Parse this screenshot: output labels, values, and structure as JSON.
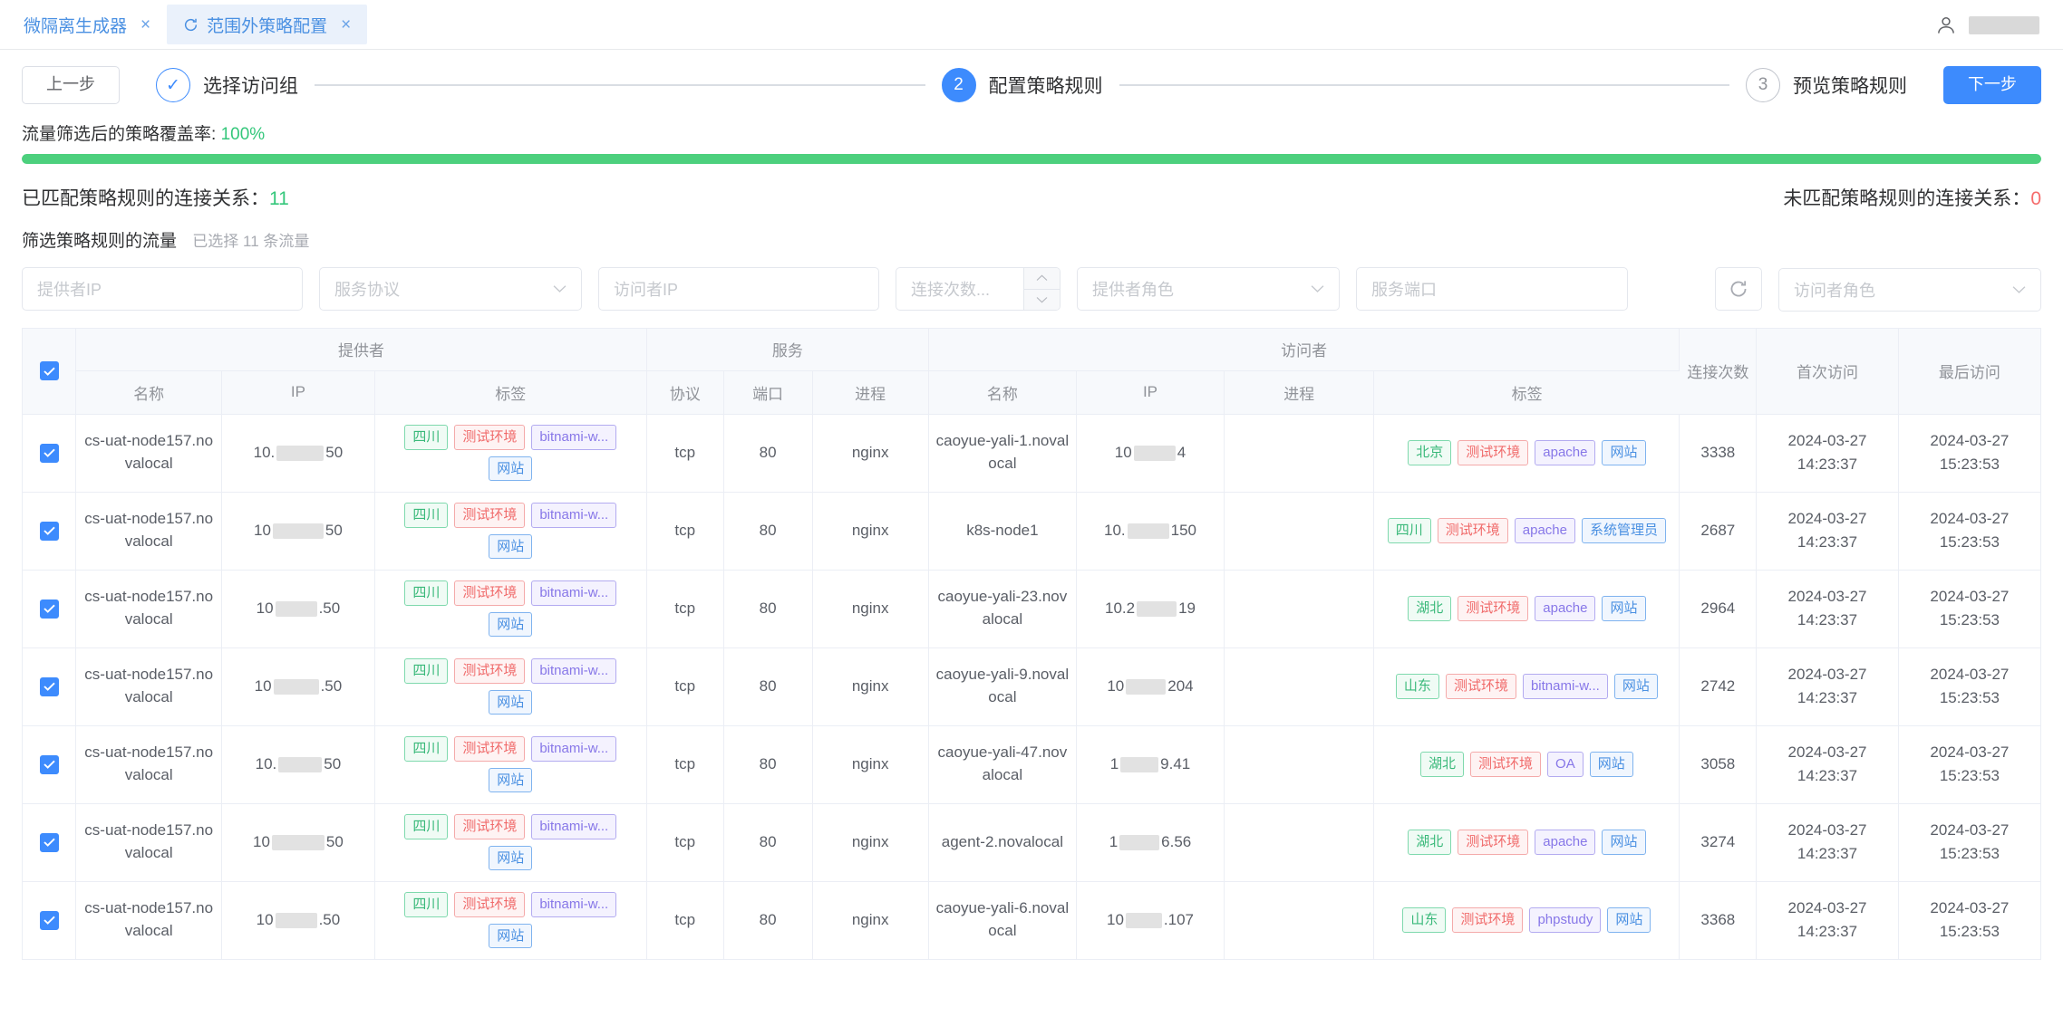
{
  "tabs": [
    {
      "label": "微隔离生成器",
      "active": false,
      "has_refresh": false,
      "close": "×"
    },
    {
      "label": "范围外策略配置",
      "active": true,
      "has_refresh": true,
      "close": "×"
    }
  ],
  "topbar": {
    "user_icon": "user-icon"
  },
  "stepbar": {
    "prev_label": "上一步",
    "next_label": "下一步",
    "steps": [
      {
        "marker": "✓",
        "label": "选择访问组",
        "state": "done"
      },
      {
        "marker": "2",
        "label": "配置策略规则",
        "state": "current"
      },
      {
        "marker": "3",
        "label": "预览策略规则",
        "state": "todo"
      }
    ]
  },
  "coverage": {
    "label": "流量筛选后的策略覆盖率:",
    "value": "100%",
    "percent": 100,
    "bar_color": "#4cd07d"
  },
  "counts": {
    "matched_label": "已匹配策略规则的连接关系：",
    "matched_value": "11",
    "matched_color": "#34c77b",
    "unmatched_label": "未匹配策略规则的连接关系：",
    "unmatched_value": "0",
    "unmatched_color": "#f56c6c"
  },
  "filter_section": {
    "title": "筛选策略规则的流量",
    "hint": "已选择 11 条流量",
    "fields": [
      {
        "name": "provider-ip",
        "placeholder": "提供者IP",
        "type": "text",
        "width": "w310"
      },
      {
        "name": "service-protocol",
        "placeholder": "服务协议",
        "type": "select",
        "width": "w290"
      },
      {
        "name": "visitor-ip",
        "placeholder": "访问者IP",
        "type": "text",
        "width": "w310"
      },
      {
        "name": "connection-count",
        "placeholder": "连接次数...",
        "type": "number",
        "width": ""
      },
      {
        "name": "provider-role",
        "placeholder": "提供者角色",
        "type": "select",
        "width": "w290"
      },
      {
        "name": "service-port",
        "placeholder": "服务端口",
        "type": "text",
        "width": "w300"
      },
      {
        "name": "visitor-role",
        "placeholder": "访问者角色",
        "type": "select",
        "width": "w290"
      }
    ],
    "refresh_icon": "refresh-icon"
  },
  "table": {
    "group_headers": [
      {
        "label": "提供者",
        "span": 3
      },
      {
        "label": "服务",
        "span": 3
      },
      {
        "label": "访问者",
        "span": 4
      },
      {
        "label": "连接次数",
        "span": 1,
        "rowspan": true
      },
      {
        "label": "首次访问",
        "span": 1,
        "rowspan": true
      },
      {
        "label": "最后访问",
        "span": 1,
        "rowspan": true
      }
    ],
    "sub_headers": [
      "名称",
      "IP",
      "标签",
      "协议",
      "端口",
      "进程",
      "名称",
      "IP",
      "进程",
      "标签"
    ],
    "header_all_checked": true,
    "rows": [
      {
        "checked": true,
        "provider_name": "cs-uat-node157.novalocal",
        "provider_ip_prefix": "10.",
        "provider_ip_suffix": "50",
        "provider_ip_blur_w": 52,
        "provider_tags": [
          {
            "text": "四川",
            "color": "green"
          },
          {
            "text": "测试环境",
            "color": "red"
          },
          {
            "text": "bitnami-w...",
            "color": "purple"
          },
          {
            "text": "网站",
            "color": "blue"
          }
        ],
        "protocol": "tcp",
        "port": "80",
        "process": "nginx",
        "visitor_name": "caoyue-yali-1.novalocal",
        "visitor_ip_prefix": "10",
        "visitor_ip_suffix": "4",
        "visitor_ip_blur_w": 46,
        "visitor_process": "",
        "visitor_tags": [
          {
            "text": "北京",
            "color": "green"
          },
          {
            "text": "测试环境",
            "color": "red"
          },
          {
            "text": "apache",
            "color": "purple"
          },
          {
            "text": "网站",
            "color": "blue"
          }
        ],
        "conn_count": "3338",
        "first_visit_date": "2024-03-27",
        "first_visit_time": "14:23:37",
        "last_visit_date": "2024-03-27",
        "last_visit_time": "15:23:53"
      },
      {
        "checked": true,
        "provider_name": "cs-uat-node157.novalocal",
        "provider_ip_prefix": "10",
        "provider_ip_suffix": "50",
        "provider_ip_blur_w": 56,
        "provider_tags": [
          {
            "text": "四川",
            "color": "green"
          },
          {
            "text": "测试环境",
            "color": "red"
          },
          {
            "text": "bitnami-w...",
            "color": "purple"
          },
          {
            "text": "网站",
            "color": "blue"
          }
        ],
        "protocol": "tcp",
        "port": "80",
        "process": "nginx",
        "visitor_name": "k8s-node1",
        "visitor_ip_prefix": "10.",
        "visitor_ip_suffix": "150",
        "visitor_ip_blur_w": 46,
        "visitor_process": "",
        "visitor_tags": [
          {
            "text": "四川",
            "color": "green"
          },
          {
            "text": "测试环境",
            "color": "red"
          },
          {
            "text": "apache",
            "color": "purple"
          },
          {
            "text": "系统管理员",
            "color": "blue"
          }
        ],
        "conn_count": "2687",
        "first_visit_date": "2024-03-27",
        "first_visit_time": "14:23:37",
        "last_visit_date": "2024-03-27",
        "last_visit_time": "15:23:53"
      },
      {
        "checked": true,
        "provider_name": "cs-uat-node157.novalocal",
        "provider_ip_prefix": "10",
        "provider_ip_suffix": ".50",
        "provider_ip_blur_w": 46,
        "provider_tags": [
          {
            "text": "四川",
            "color": "green"
          },
          {
            "text": "测试环境",
            "color": "red"
          },
          {
            "text": "bitnami-w...",
            "color": "purple"
          },
          {
            "text": "网站",
            "color": "blue"
          }
        ],
        "protocol": "tcp",
        "port": "80",
        "process": "nginx",
        "visitor_name": "caoyue-yali-23.novalocal",
        "visitor_ip_prefix": "10.2",
        "visitor_ip_suffix": "19",
        "visitor_ip_blur_w": 44,
        "visitor_process": "",
        "visitor_tags": [
          {
            "text": "湖北",
            "color": "green"
          },
          {
            "text": "测试环境",
            "color": "red"
          },
          {
            "text": "apache",
            "color": "purple"
          },
          {
            "text": "网站",
            "color": "blue"
          }
        ],
        "conn_count": "2964",
        "first_visit_date": "2024-03-27",
        "first_visit_time": "14:23:37",
        "last_visit_date": "2024-03-27",
        "last_visit_time": "15:23:53"
      },
      {
        "checked": true,
        "provider_name": "cs-uat-node157.novalocal",
        "provider_ip_prefix": "10",
        "provider_ip_suffix": ".50",
        "provider_ip_blur_w": 50,
        "provider_tags": [
          {
            "text": "四川",
            "color": "green"
          },
          {
            "text": "测试环境",
            "color": "red"
          },
          {
            "text": "bitnami-w...",
            "color": "purple"
          },
          {
            "text": "网站",
            "color": "blue"
          }
        ],
        "protocol": "tcp",
        "port": "80",
        "process": "nginx",
        "visitor_name": "caoyue-yali-9.novalocal",
        "visitor_ip_prefix": "10",
        "visitor_ip_suffix": "204",
        "visitor_ip_blur_w": 44,
        "visitor_process": "",
        "visitor_tags": [
          {
            "text": "山东",
            "color": "green"
          },
          {
            "text": "测试环境",
            "color": "red"
          },
          {
            "text": "bitnami-w...",
            "color": "purple"
          },
          {
            "text": "网站",
            "color": "blue"
          }
        ],
        "conn_count": "2742",
        "first_visit_date": "2024-03-27",
        "first_visit_time": "14:23:37",
        "last_visit_date": "2024-03-27",
        "last_visit_time": "15:23:53"
      },
      {
        "checked": true,
        "provider_name": "cs-uat-node157.novalocal",
        "provider_ip_prefix": "10.",
        "provider_ip_suffix": "50",
        "provider_ip_blur_w": 48,
        "provider_tags": [
          {
            "text": "四川",
            "color": "green"
          },
          {
            "text": "测试环境",
            "color": "red"
          },
          {
            "text": "bitnami-w...",
            "color": "purple"
          },
          {
            "text": "网站",
            "color": "blue"
          }
        ],
        "protocol": "tcp",
        "port": "80",
        "process": "nginx",
        "visitor_name": "caoyue-yali-47.novalocal",
        "visitor_ip_prefix": "1",
        "visitor_ip_suffix": "9.41",
        "visitor_ip_blur_w": 42,
        "visitor_process": "",
        "visitor_tags": [
          {
            "text": "湖北",
            "color": "green"
          },
          {
            "text": "测试环境",
            "color": "red"
          },
          {
            "text": "OA",
            "color": "purple"
          },
          {
            "text": "网站",
            "color": "blue"
          }
        ],
        "conn_count": "3058",
        "first_visit_date": "2024-03-27",
        "first_visit_time": "14:23:37",
        "last_visit_date": "2024-03-27",
        "last_visit_time": "15:23:53"
      },
      {
        "checked": true,
        "provider_name": "cs-uat-node157.novalocal",
        "provider_ip_prefix": "10",
        "provider_ip_suffix": "50",
        "provider_ip_blur_w": 58,
        "provider_tags": [
          {
            "text": "四川",
            "color": "green"
          },
          {
            "text": "测试环境",
            "color": "red"
          },
          {
            "text": "bitnami-w...",
            "color": "purple"
          },
          {
            "text": "网站",
            "color": "blue"
          }
        ],
        "protocol": "tcp",
        "port": "80",
        "process": "nginx",
        "visitor_name": "agent-2.novalocal",
        "visitor_ip_prefix": "1",
        "visitor_ip_suffix": "6.56",
        "visitor_ip_blur_w": 44,
        "visitor_process": "",
        "visitor_tags": [
          {
            "text": "湖北",
            "color": "green"
          },
          {
            "text": "测试环境",
            "color": "red"
          },
          {
            "text": "apache",
            "color": "purple"
          },
          {
            "text": "网站",
            "color": "blue"
          }
        ],
        "conn_count": "3274",
        "first_visit_date": "2024-03-27",
        "first_visit_time": "14:23:37",
        "last_visit_date": "2024-03-27",
        "last_visit_time": "15:23:53"
      },
      {
        "checked": true,
        "provider_name": "cs-uat-node157.novalocal",
        "provider_ip_prefix": "10",
        "provider_ip_suffix": ".50",
        "provider_ip_blur_w": 46,
        "provider_tags": [
          {
            "text": "四川",
            "color": "green"
          },
          {
            "text": "测试环境",
            "color": "red"
          },
          {
            "text": "bitnami-w...",
            "color": "purple"
          },
          {
            "text": "网站",
            "color": "blue"
          }
        ],
        "protocol": "tcp",
        "port": "80",
        "process": "nginx",
        "visitor_name": "caoyue-yali-6.novalocal",
        "visitor_ip_prefix": "10",
        "visitor_ip_suffix": ".107",
        "visitor_ip_blur_w": 40,
        "visitor_process": "",
        "visitor_tags": [
          {
            "text": "山东",
            "color": "green"
          },
          {
            "text": "测试环境",
            "color": "red"
          },
          {
            "text": "phpstudy",
            "color": "purple"
          },
          {
            "text": "网站",
            "color": "blue"
          }
        ],
        "conn_count": "3368",
        "first_visit_date": "2024-03-27",
        "first_visit_time": "14:23:37",
        "last_visit_date": "2024-03-27",
        "last_visit_time": "15:23:53"
      }
    ]
  }
}
